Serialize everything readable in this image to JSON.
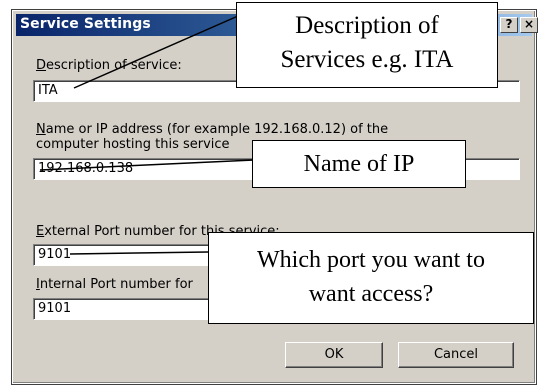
{
  "dialog": {
    "title": "Service Settings",
    "help_button": "?",
    "close_button": "×"
  },
  "description": {
    "label_accel": "D",
    "label_rest": "escription of service:",
    "value": "ITA"
  },
  "host": {
    "label_accel": "N",
    "label_line1_rest": "ame or IP address (for example 192.168.0.12) of the",
    "label_line2": "computer hosting this service",
    "value": "192.168.0.138"
  },
  "external_port": {
    "label_accel": "E",
    "label_rest": "xternal Port number for this service:",
    "value": "9101"
  },
  "internal_port": {
    "label_accel": "I",
    "label_rest": "nternal Port number for",
    "value": "9101"
  },
  "buttons": {
    "ok": "OK",
    "cancel": "Cancel"
  },
  "annotations": {
    "description_line1": "Description of",
    "description_line2": "Services e.g. ITA",
    "ip": "Name of IP",
    "port_line1": "Which port you want to",
    "port_line2": "want access?"
  }
}
